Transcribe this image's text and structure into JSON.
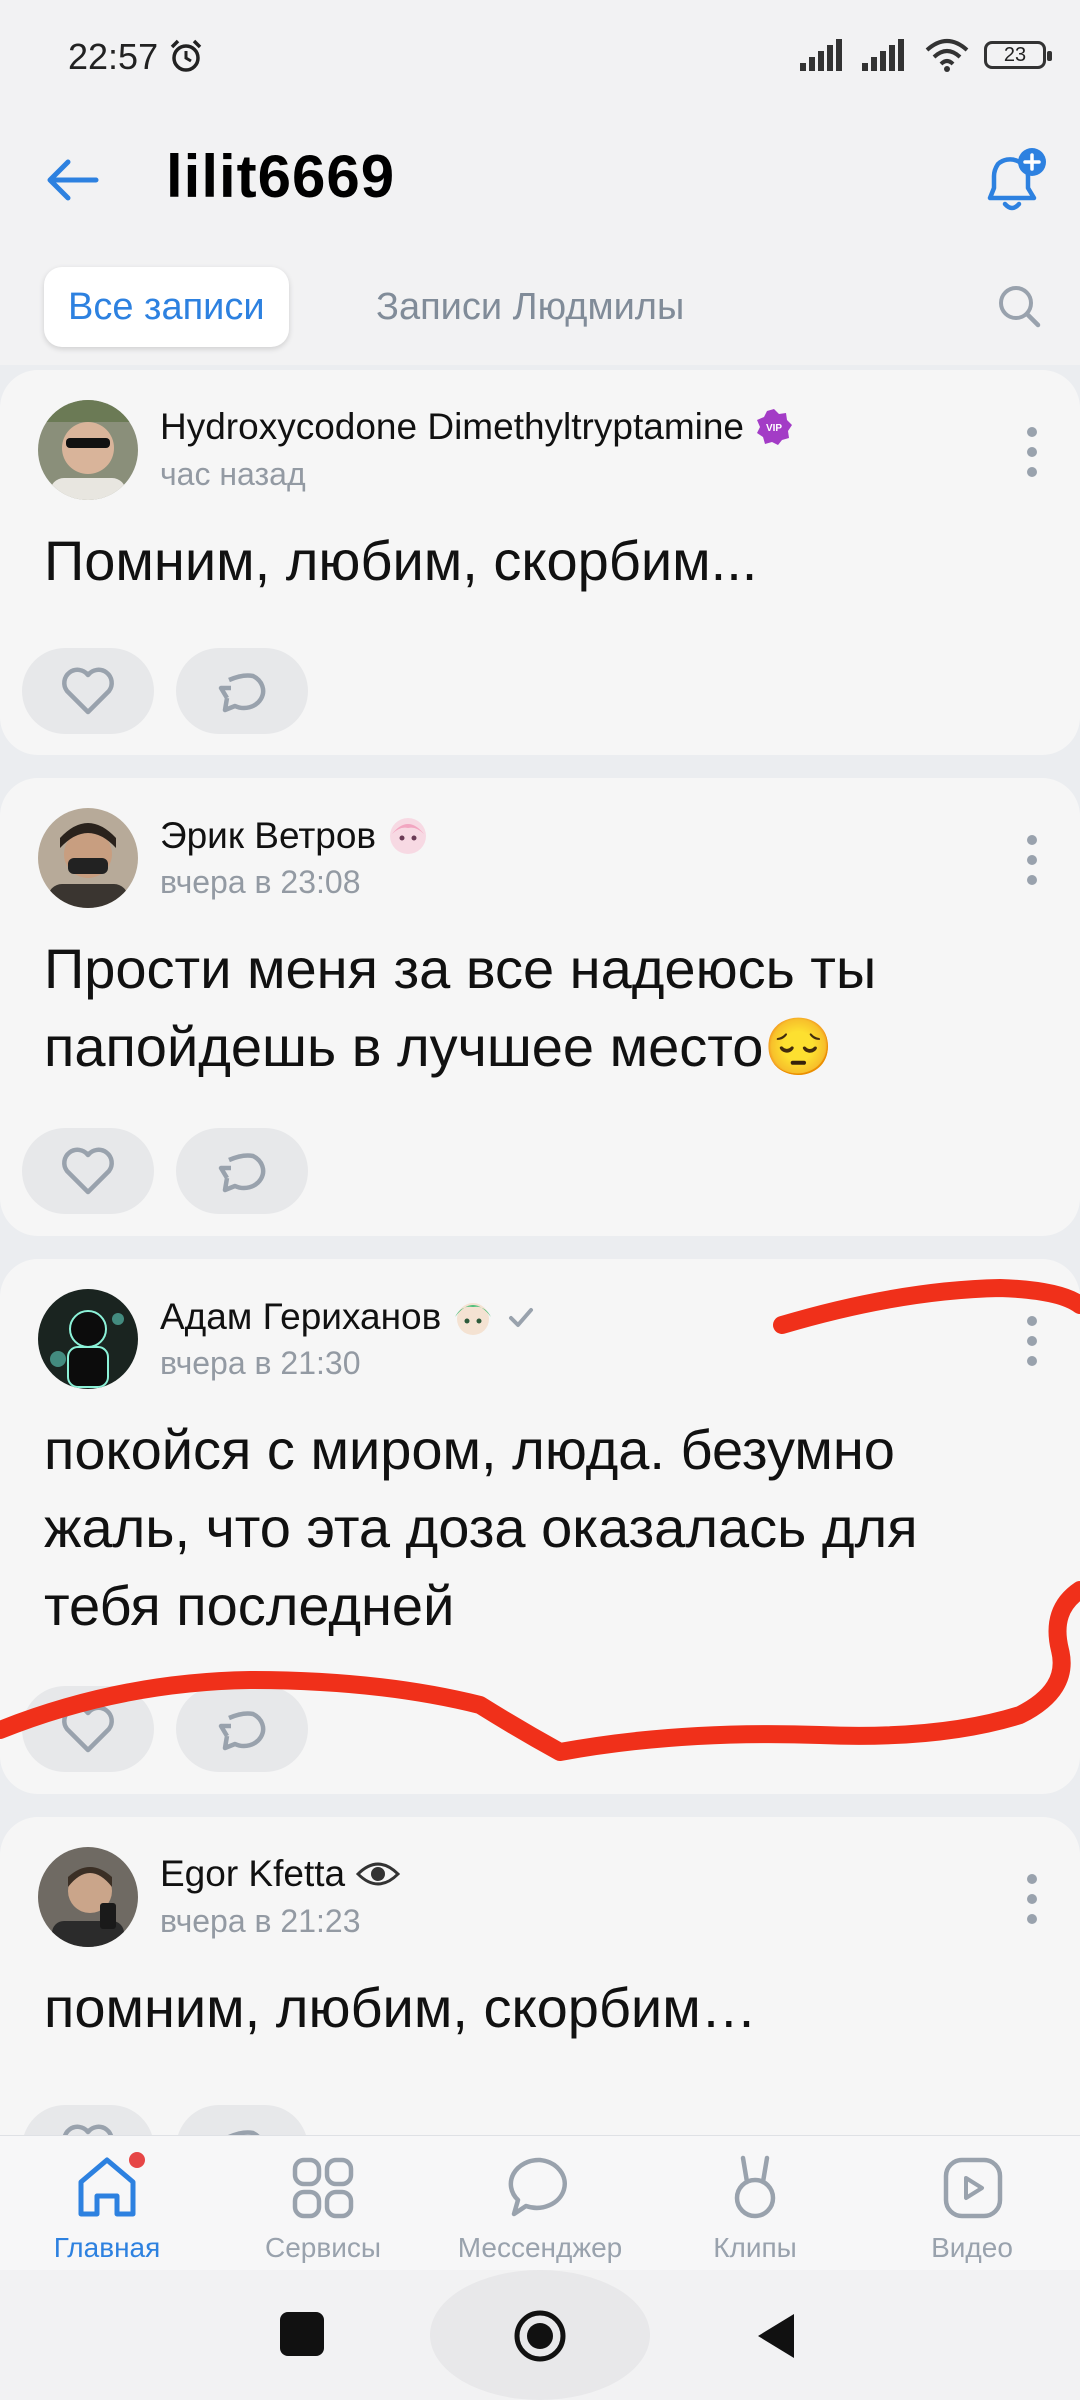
{
  "status_bar": {
    "time": "22:57",
    "battery": "23"
  },
  "header": {
    "title": "lilit6669"
  },
  "tabs": [
    {
      "label": "Все записи"
    },
    {
      "label": "Записи Людмилы"
    }
  ],
  "posts": [
    {
      "author": "Hydroxycodone Dimethyltryptamine",
      "time": "час назад",
      "text": "Помним, любим, скорбим..."
    },
    {
      "author": "Эрик Ветров",
      "time": "вчера в 23:08",
      "text": "Прости меня за все надеюсь ты папойдешь в лучшее место😔"
    },
    {
      "author": "Адам Гериханов",
      "time": "вчера в 21:30",
      "text": "покойся с миром, люда. безумно жаль, что эта доза оказалась для тебя последней"
    },
    {
      "author": "Egor Kfetta",
      "time": "вчера в 21:23",
      "text": "помним, любим, скорбим…"
    }
  ],
  "bottom_nav": [
    {
      "label": "Главная"
    },
    {
      "label": "Сервисы"
    },
    {
      "label": "Мессенджер"
    },
    {
      "label": "Клипы"
    },
    {
      "label": "Видео"
    }
  ],
  "colors": {
    "accent": "#2d81e0",
    "muted": "#99a2ad",
    "scribble": "#f0301a"
  }
}
